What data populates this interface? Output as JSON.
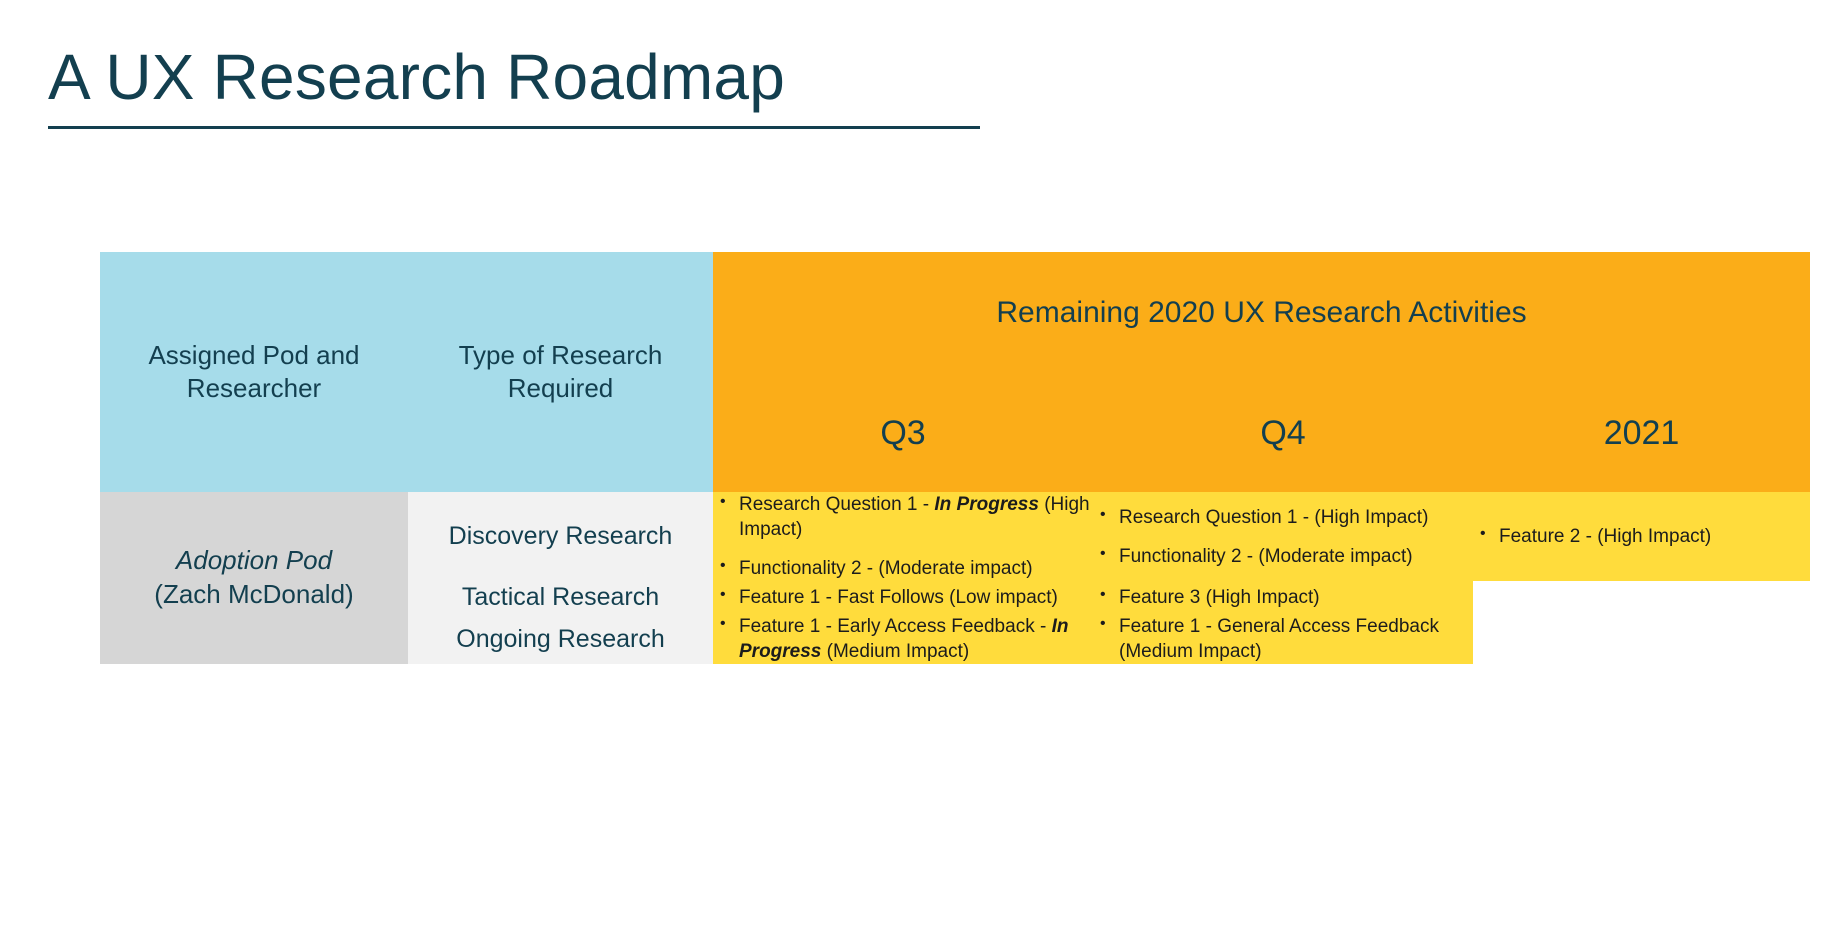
{
  "slide": {
    "title": "A UX Research Roadmap"
  },
  "table": {
    "headers": {
      "pod": "Assigned Pod and Researcher",
      "type": "Type of Research Required",
      "activities_group": "Remaining 2020 UX Research Activities",
      "q3": "Q3",
      "q4": "Q4",
      "y2021": "2021"
    },
    "pod": {
      "name": "Adoption Pod",
      "person": "(Zach McDonald)"
    },
    "rows": [
      {
        "type": "Discovery Research",
        "q3": [
          {
            "text": "Research Question 1  - ",
            "bold": "In Progress",
            "tail": " (High Impact)"
          },
          {
            "text": "Functionality 2 - (Moderate impact)",
            "bold": "",
            "tail": ""
          }
        ],
        "q4": [
          {
            "text": "Research Question 1  - (High Impact)",
            "bold": "",
            "tail": ""
          },
          {
            "text": "Functionality 2 - (Moderate impact)",
            "bold": "",
            "tail": ""
          }
        ],
        "y2021": [
          {
            "text": "Feature 2 - (High Impact)",
            "bold": "",
            "tail": ""
          }
        ]
      },
      {
        "type": "Tactical Research",
        "q3": [
          {
            "text": "Feature 1 - Fast Follows (Low impact)",
            "bold": "",
            "tail": ""
          }
        ],
        "q4": [
          {
            "text": "Feature 3 (High Impact)",
            "bold": "",
            "tail": ""
          }
        ],
        "y2021": []
      },
      {
        "type": "Ongoing Research",
        "q3": [
          {
            "text": "Feature 1 - Early Access Feedback - ",
            "bold": "In Progress",
            "tail": " (Medium Impact)"
          }
        ],
        "q4": [
          {
            "text": "Feature 1  - General Access Feedback (Medium Impact)",
            "bold": "",
            "tail": ""
          }
        ],
        "y2021": []
      }
    ]
  },
  "colors": {
    "title_text": "#133F4F",
    "header_blue": "#A6DCEA",
    "header_orange": "#FBAD18",
    "cell_yellow": "#FFDC3C",
    "pod_gray": "#D6D6D6",
    "type_gray": "#F2F2F2"
  }
}
